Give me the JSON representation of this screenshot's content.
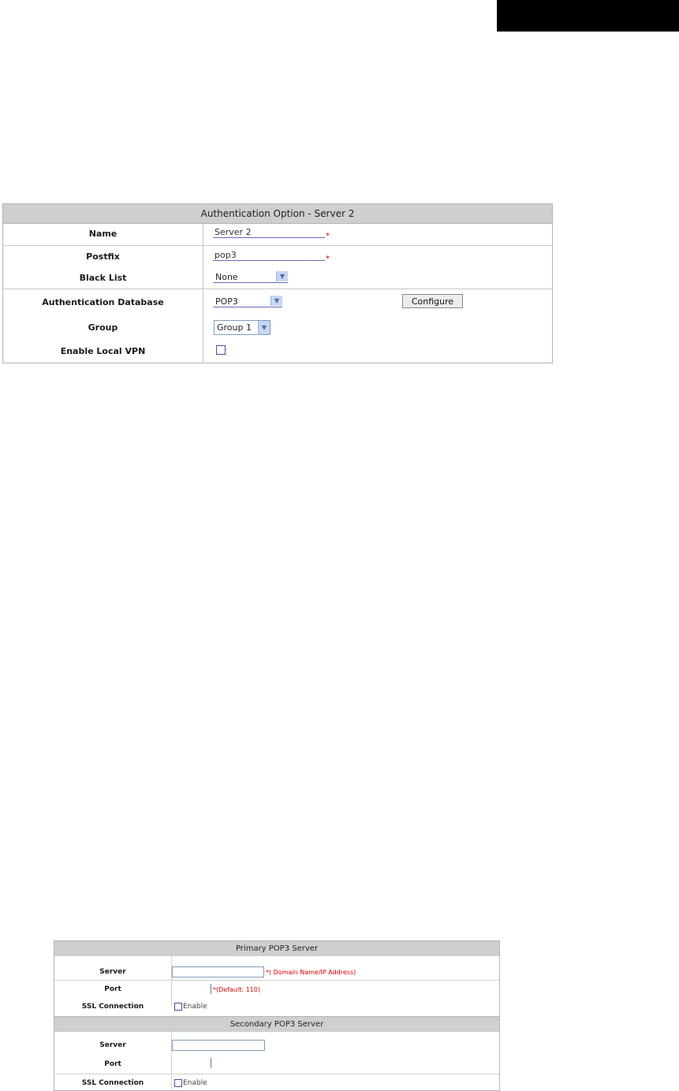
{
  "auth_option": {
    "header": "Authentication Option - Server 2",
    "rows": [
      {
        "label": "Name",
        "value": "Server 2",
        "required": "*"
      },
      {
        "label": "Postfix",
        "value": "pop3",
        "required": "*"
      },
      {
        "label": "Black List",
        "value": "None"
      },
      {
        "label": "Authentication Database",
        "value": "POP3",
        "button": "Configure"
      },
      {
        "label": "Group",
        "value": "Group 1"
      },
      {
        "label": "Enable Local VPN"
      }
    ]
  },
  "pop3": {
    "primary_header": "Primary POP3 Server",
    "secondary_header": "Secondary POP3 Server",
    "server_label": "Server",
    "port_label": "Port",
    "ssl_label": "SSL Connection",
    "enable_label": "Enable",
    "server_hint": "*( Domain Name/IP Address)",
    "port_hint": "*(Default: 110)"
  }
}
